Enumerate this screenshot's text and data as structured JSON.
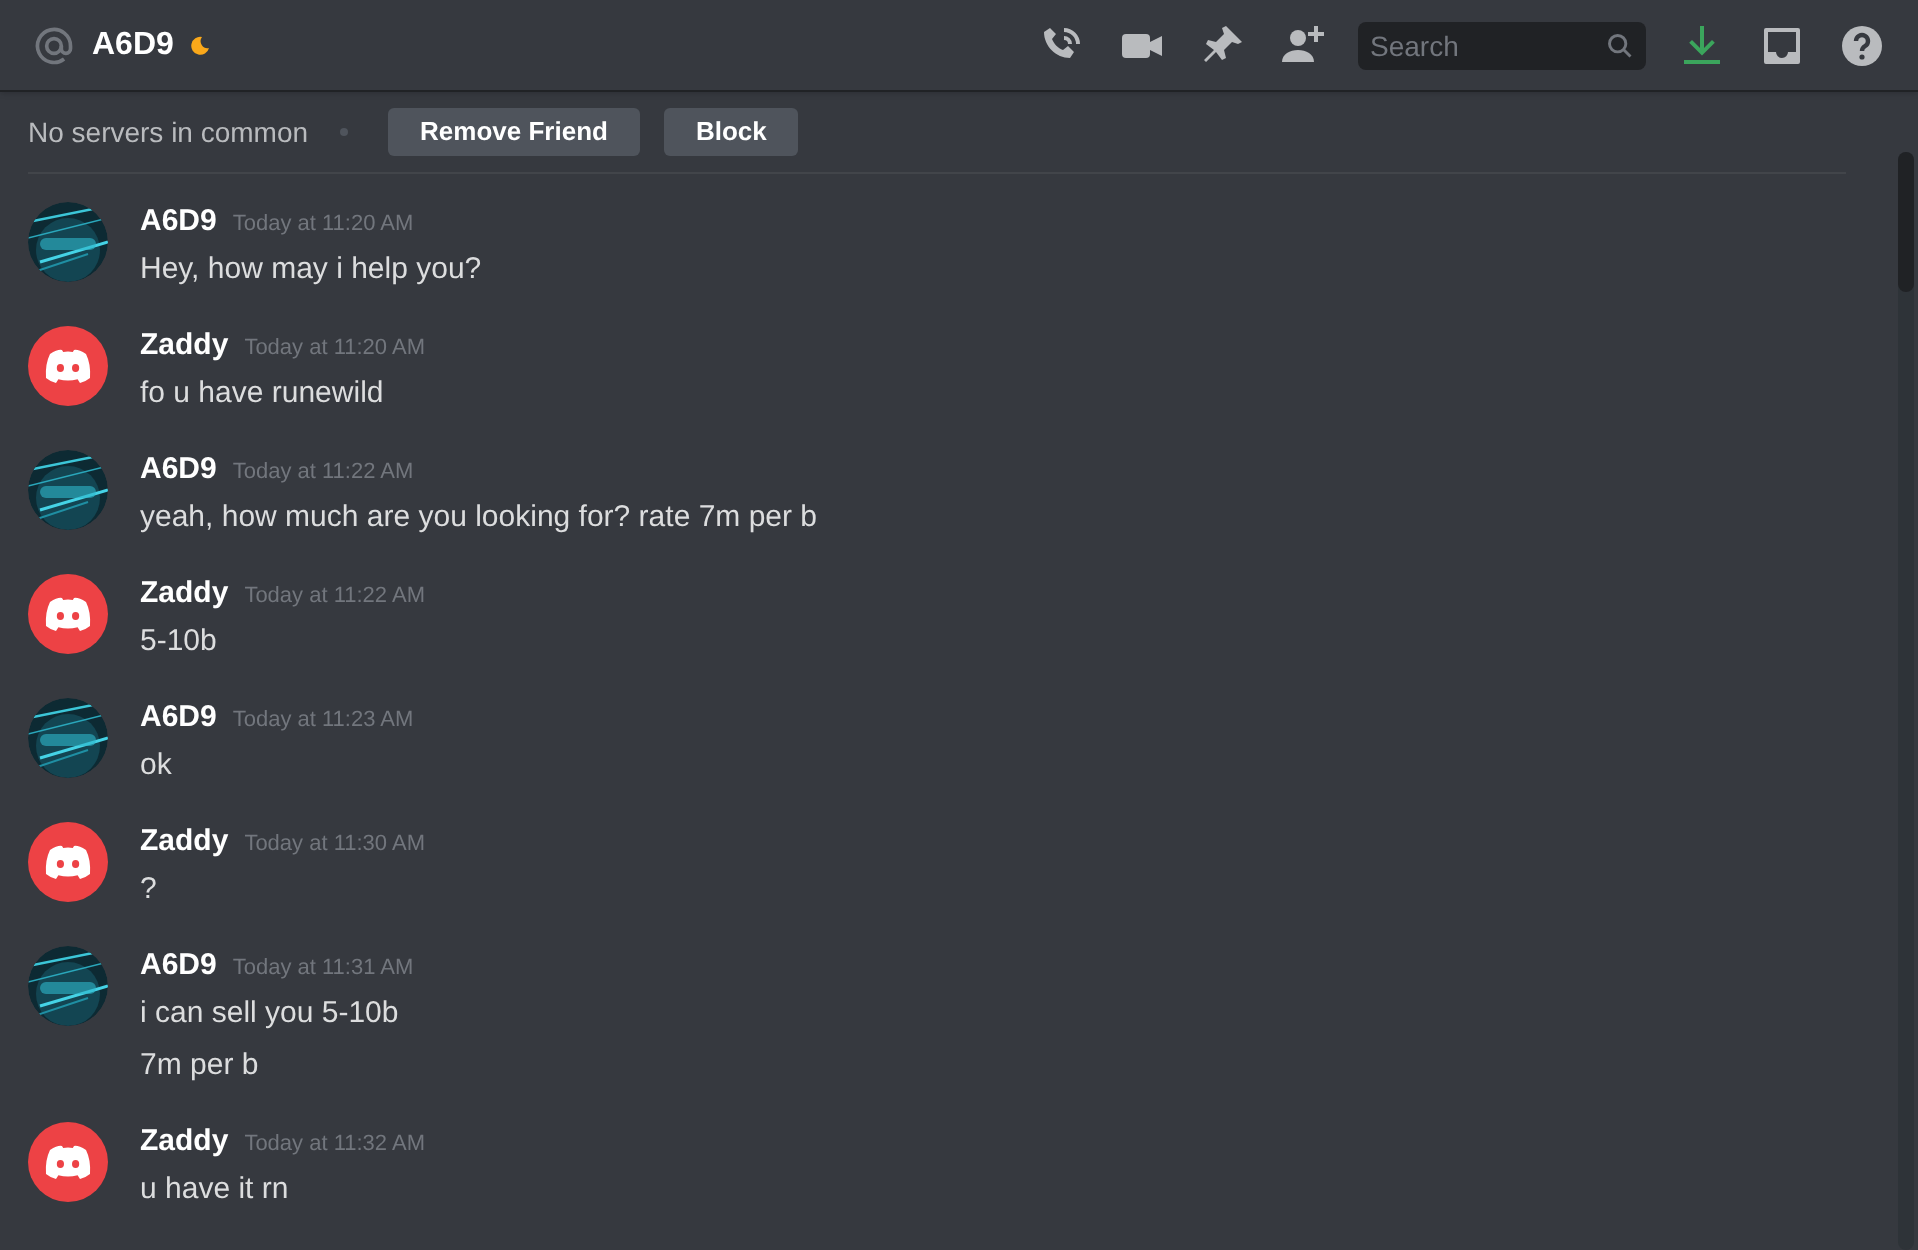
{
  "header": {
    "title": "A6D9",
    "search": {
      "placeholder": "Search"
    }
  },
  "profile_bar": {
    "mutual": "No servers in common",
    "buttons": [
      "Remove Friend",
      "Block"
    ]
  },
  "messages": [
    {
      "author": "A6D9",
      "kind": "picture",
      "time": "Today at 11:20 AM",
      "lines": [
        "Hey, how may i help you?"
      ]
    },
    {
      "author": "Zaddy",
      "kind": "default",
      "time": "Today at 11:20 AM",
      "lines": [
        "fo u have runewild"
      ]
    },
    {
      "author": "A6D9",
      "kind": "picture",
      "time": "Today at 11:22 AM",
      "lines": [
        "yeah, how much are you looking for? rate 7m per b"
      ]
    },
    {
      "author": "Zaddy",
      "kind": "default",
      "time": "Today at 11:22 AM",
      "lines": [
        "5-10b"
      ]
    },
    {
      "author": "A6D9",
      "kind": "picture",
      "time": "Today at 11:23 AM",
      "lines": [
        "ok"
      ]
    },
    {
      "author": "Zaddy",
      "kind": "default",
      "time": "Today at 11:30 AM",
      "lines": [
        "?"
      ]
    },
    {
      "author": "A6D9",
      "kind": "picture",
      "time": "Today at 11:31 AM",
      "lines": [
        "i can sell you 5-10b",
        "7m per b"
      ]
    },
    {
      "author": "Zaddy",
      "kind": "default",
      "time": "Today at 11:32 AM",
      "lines": [
        "u have it rn"
      ]
    }
  ]
}
